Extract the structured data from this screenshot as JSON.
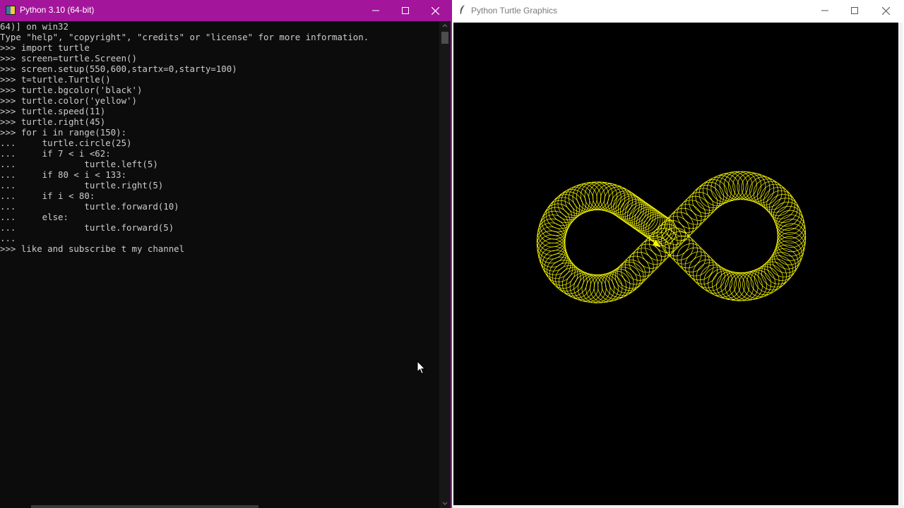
{
  "console": {
    "title": "Python 3.10 (64-bit)",
    "lines": [
      "64)] on win32",
      "Type \"help\", \"copyright\", \"credits\" or \"license\" for more information.",
      ">>> import turtle",
      ">>> screen=turtle.Screen()",
      ">>> screen.setup(550,600,startx=0,starty=100)",
      ">>> t=turtle.Turtle()",
      ">>> turtle.bgcolor('black')",
      ">>> turtle.color('yellow')",
      ">>> turtle.speed(11)",
      ">>> turtle.right(45)",
      ">>> for i in range(150):",
      "...     turtle.circle(25)",
      "...     if 7 < i <62:",
      "...             turtle.left(5)",
      "...     if 80 < i < 133:",
      "...             turtle.right(5)",
      "...     if i < 80:",
      "...             turtle.forward(10)",
      "...     else:",
      "...             turtle.forward(5)",
      "...",
      ">>> like and subscribe t my channel"
    ],
    "icons": [
      "python-icon",
      "minimize-icon",
      "maximize-icon",
      "close-icon"
    ],
    "colors": {
      "titlebar": "#a3159b",
      "background": "#0c0c0c",
      "text": "#cccccc"
    }
  },
  "turtle_window": {
    "title": "Python Turtle Graphics",
    "icons": [
      "feather-icon",
      "minimize-icon",
      "maximize-icon",
      "close-icon"
    ],
    "colors": {
      "canvas": "#000000",
      "pen": "#ffff00"
    },
    "drawing": {
      "program": {
        "iterations": 150,
        "radius": 25,
        "initial_heading_right": 45
      }
    }
  }
}
